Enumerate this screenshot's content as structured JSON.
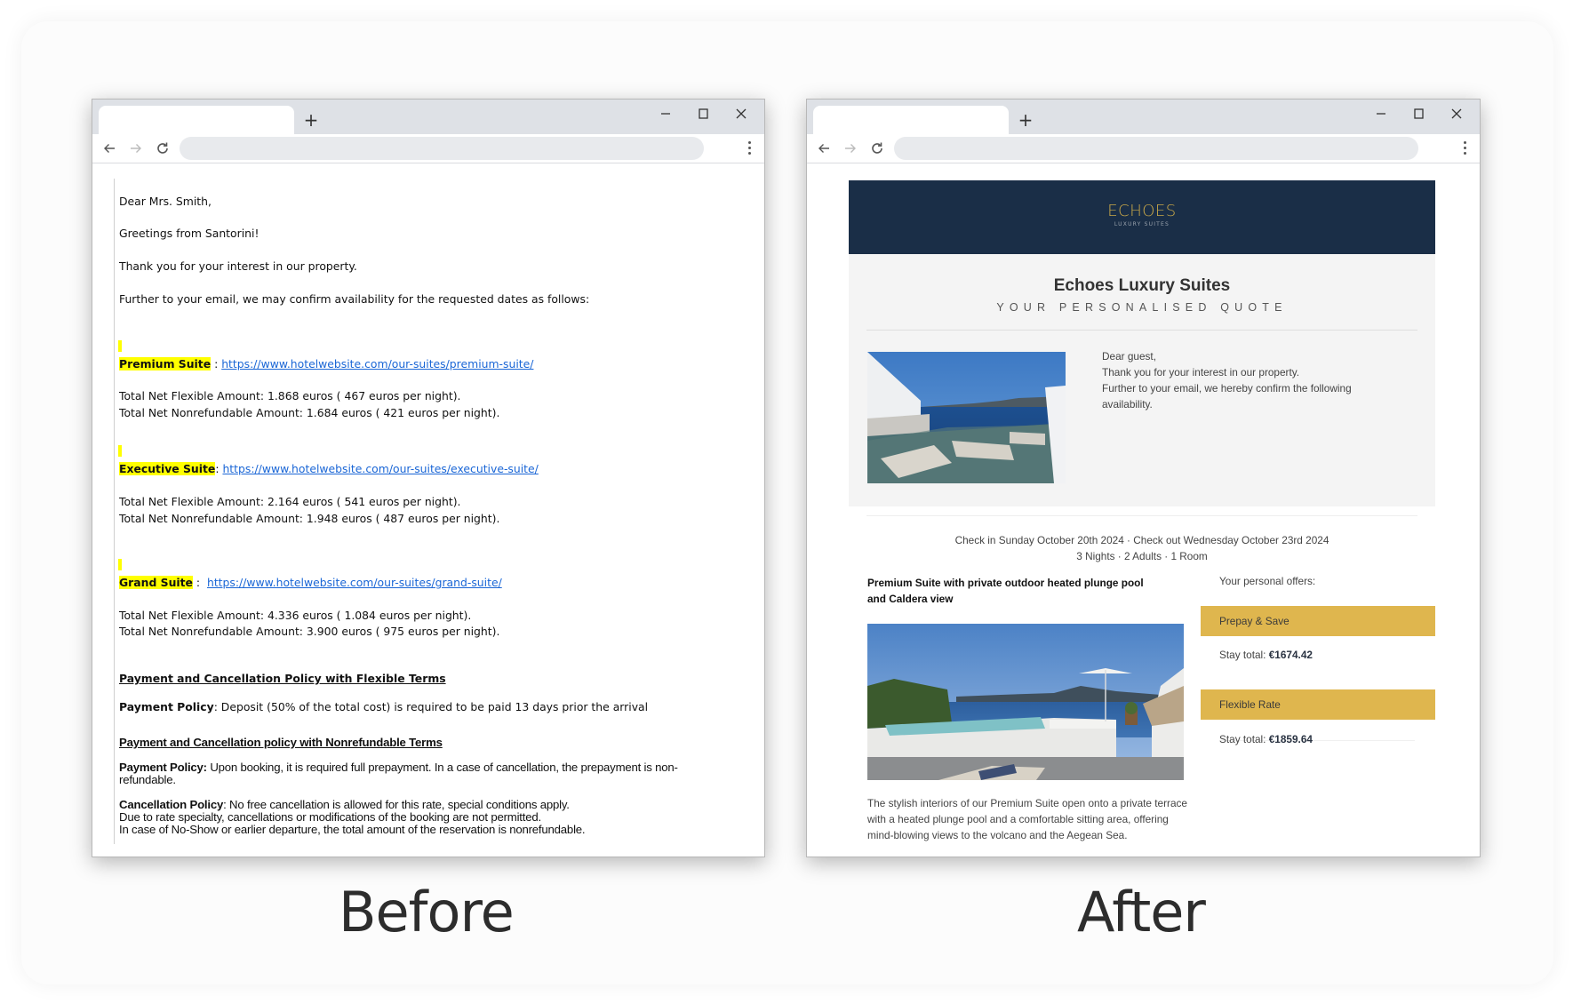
{
  "captions": {
    "before": "Before",
    "after": "After"
  },
  "browser": {
    "new_tab": "+",
    "controls": {
      "minimize": "minimize-icon",
      "maximize": "maximize-icon",
      "close": "close-icon"
    },
    "nav": {
      "back": "back-arrow-icon",
      "forward": "forward-arrow-icon",
      "reload": "reload-icon",
      "menu": "menu-dots-icon"
    },
    "address": ""
  },
  "before": {
    "salutation": "Dear Mrs. Smith,",
    "greeting": "Greetings from Santorini!",
    "thanks": "Thank you for your interest in our property.",
    "intro": "Further to your email, we may confirm availability for the requested dates as follows:",
    "suites": [
      {
        "name": "Premium Suite",
        "separator": " : ",
        "url": "https://www.hotelwebsite.com/our-suites/premium-suite/",
        "flexible": "Total Net Flexible Amount: 1.868 euros ( 467 euros per night).",
        "nonrefundable": "Total Net Nonrefundable Amount: 1.684 euros ( 421 euros per night)."
      },
      {
        "name": "Executive Suite",
        "separator": ": ",
        "url": "https://www.hotelwebsite.com/our-suites/executive-suite/",
        "flexible": "Total Net Flexible Amount: 2.164 euros ( 541 euros per night).",
        "nonrefundable": "Total Net Nonrefundable Amount: 1.948 euros ( 487 euros per night)."
      },
      {
        "name": "Grand Suite",
        "separator": " :  ",
        "url": "https://www.hotelwebsite.com/our-suites/grand-suite/",
        "flexible": "Total Net Flexible Amount: 4.336 euros ( 1.084 euros per night).",
        "nonrefundable": "Total Net Nonrefundable Amount: 3.900 euros ( 975 euros per night)."
      }
    ],
    "flexible_policy": {
      "heading": "Payment and Cancellation Policy with Flexible Terms",
      "payment_label": "Payment Policy",
      "payment_text": ": Deposit (50% of the total cost) is required to be paid 13 days prior the arrival"
    },
    "nonrefundable_policy": {
      "heading": "Payment and Cancellation policy with Nonrefundable Terms",
      "payment_label": "Payment Policy:",
      "payment_text_1": " Upon booking, it is required full prepayment. In a case of cancellation, the prepayment is non-",
      "payment_text_2": "refundable.",
      "cancellation_label": "Cancellation Policy",
      "cancellation_text_1": ": No free cancellation is allowed for this rate, special conditions apply.",
      "cancellation_text_2": "Due to rate specialty, cancellations or modifications of the booking are not permitted.",
      "cancellation_text_3": "In case of No-Show or earlier departure, the total amount of the reservation is nonrefundable."
    }
  },
  "after": {
    "logo": {
      "name": "ECHOES",
      "sub": "LUXURY SUITES",
      "color": "#c9a848"
    },
    "brand_color": "#1a2e47",
    "title": "Echoes Luxury Suites",
    "subtitle": "YOUR PERSONALISED QUOTE",
    "greeting": [
      "Dear guest,",
      "Thank you for your interest in our property.",
      "Further to your email, we hereby confirm the following availability."
    ],
    "stay_line_1": "Check in Sunday October 20th 2024 · Check out Wednesday October 23rd 2024",
    "stay_line_2": "3 Nights · 2 Adults · 1 Room",
    "suite_title": "Premium Suite with private outdoor heated plunge pool and Caldera view",
    "suite_description": "The stylish interiors of our Premium Suite open onto a private terrace with a heated plunge pool and a comfortable sitting area, offering mind-blowing views to the volcano and the Aegean Sea.",
    "offers_label": "Your personal offers:",
    "offer_color": "#dfb64e",
    "offers": [
      {
        "name": "Prepay & Save",
        "total_label": "Stay total: ",
        "total": "€1674.42"
      },
      {
        "name": "Flexible Rate",
        "total_label": "Stay total: ",
        "total": "€1859.64"
      }
    ],
    "images": {
      "hero": "infinity-pool-caldera-photo",
      "suite": "terrace-plunge-pool-photo"
    }
  }
}
